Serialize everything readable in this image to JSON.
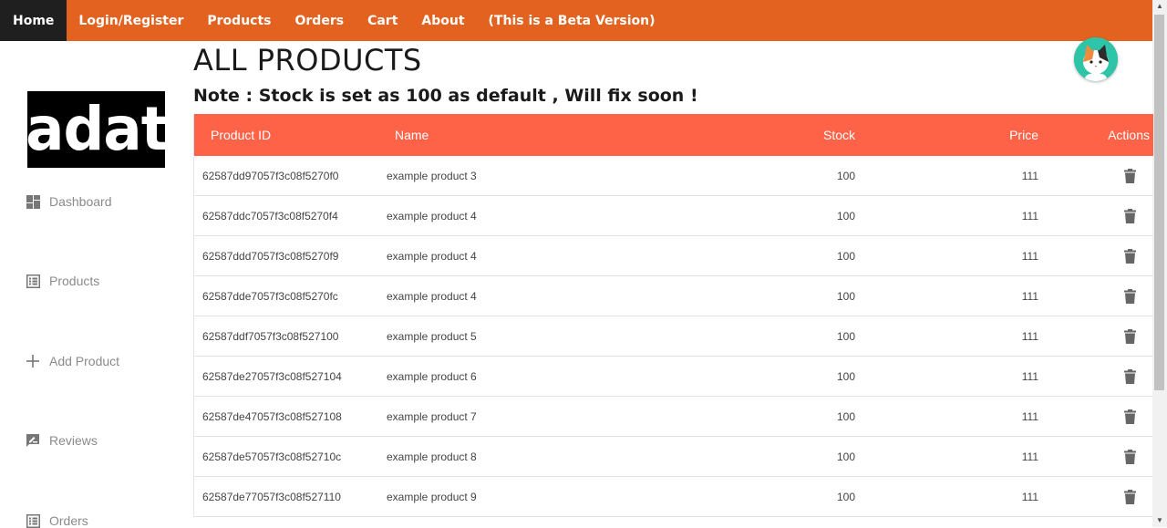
{
  "nav": {
    "items": [
      {
        "label": "Home",
        "active": true
      },
      {
        "label": "Login/Register"
      },
      {
        "label": "Products"
      },
      {
        "label": "Orders"
      },
      {
        "label": "Cart"
      },
      {
        "label": "About"
      },
      {
        "label": "(This is a Beta Version)"
      }
    ],
    "color": "#e4621f",
    "active_color": "#1f1f1f"
  },
  "sidebar": {
    "logo_text": "adat",
    "items": [
      {
        "label": "Dashboard",
        "icon": "dashboard-icon"
      },
      {
        "label": "Products",
        "icon": "list-icon"
      },
      {
        "label": "Add Product",
        "icon": "plus-icon"
      },
      {
        "label": "Reviews",
        "icon": "rate-review-icon"
      },
      {
        "label": "Orders",
        "icon": "list-icon"
      }
    ]
  },
  "main": {
    "title": "ALL PRODUCTS",
    "note": "Note : Stock is set as 100 as default , Will fix soon !"
  },
  "table": {
    "header_color": "#ff6347",
    "columns": [
      "Product ID",
      "Name",
      "Stock",
      "Price",
      "Actions"
    ],
    "rows": [
      {
        "id": "62587dd97057f3c08f5270f0",
        "name": "example product 3",
        "stock": "100",
        "price": "111"
      },
      {
        "id": "62587ddc7057f3c08f5270f4",
        "name": "example product 4",
        "stock": "100",
        "price": "111"
      },
      {
        "id": "62587ddd7057f3c08f5270f9",
        "name": "example product 4",
        "stock": "100",
        "price": "111"
      },
      {
        "id": "62587dde7057f3c08f5270fc",
        "name": "example product 4",
        "stock": "100",
        "price": "111"
      },
      {
        "id": "62587ddf7057f3c08f527100",
        "name": "example product 5",
        "stock": "100",
        "price": "111"
      },
      {
        "id": "62587de27057f3c08f527104",
        "name": "example product 6",
        "stock": "100",
        "price": "111"
      },
      {
        "id": "62587de47057f3c08f527108",
        "name": "example product 7",
        "stock": "100",
        "price": "111"
      },
      {
        "id": "62587de57057f3c08f52710c",
        "name": "example product 8",
        "stock": "100",
        "price": "111"
      },
      {
        "id": "62587de77057f3c08f527110",
        "name": "example product 9",
        "stock": "100",
        "price": "111"
      }
    ],
    "action_icon": "trash-icon"
  }
}
